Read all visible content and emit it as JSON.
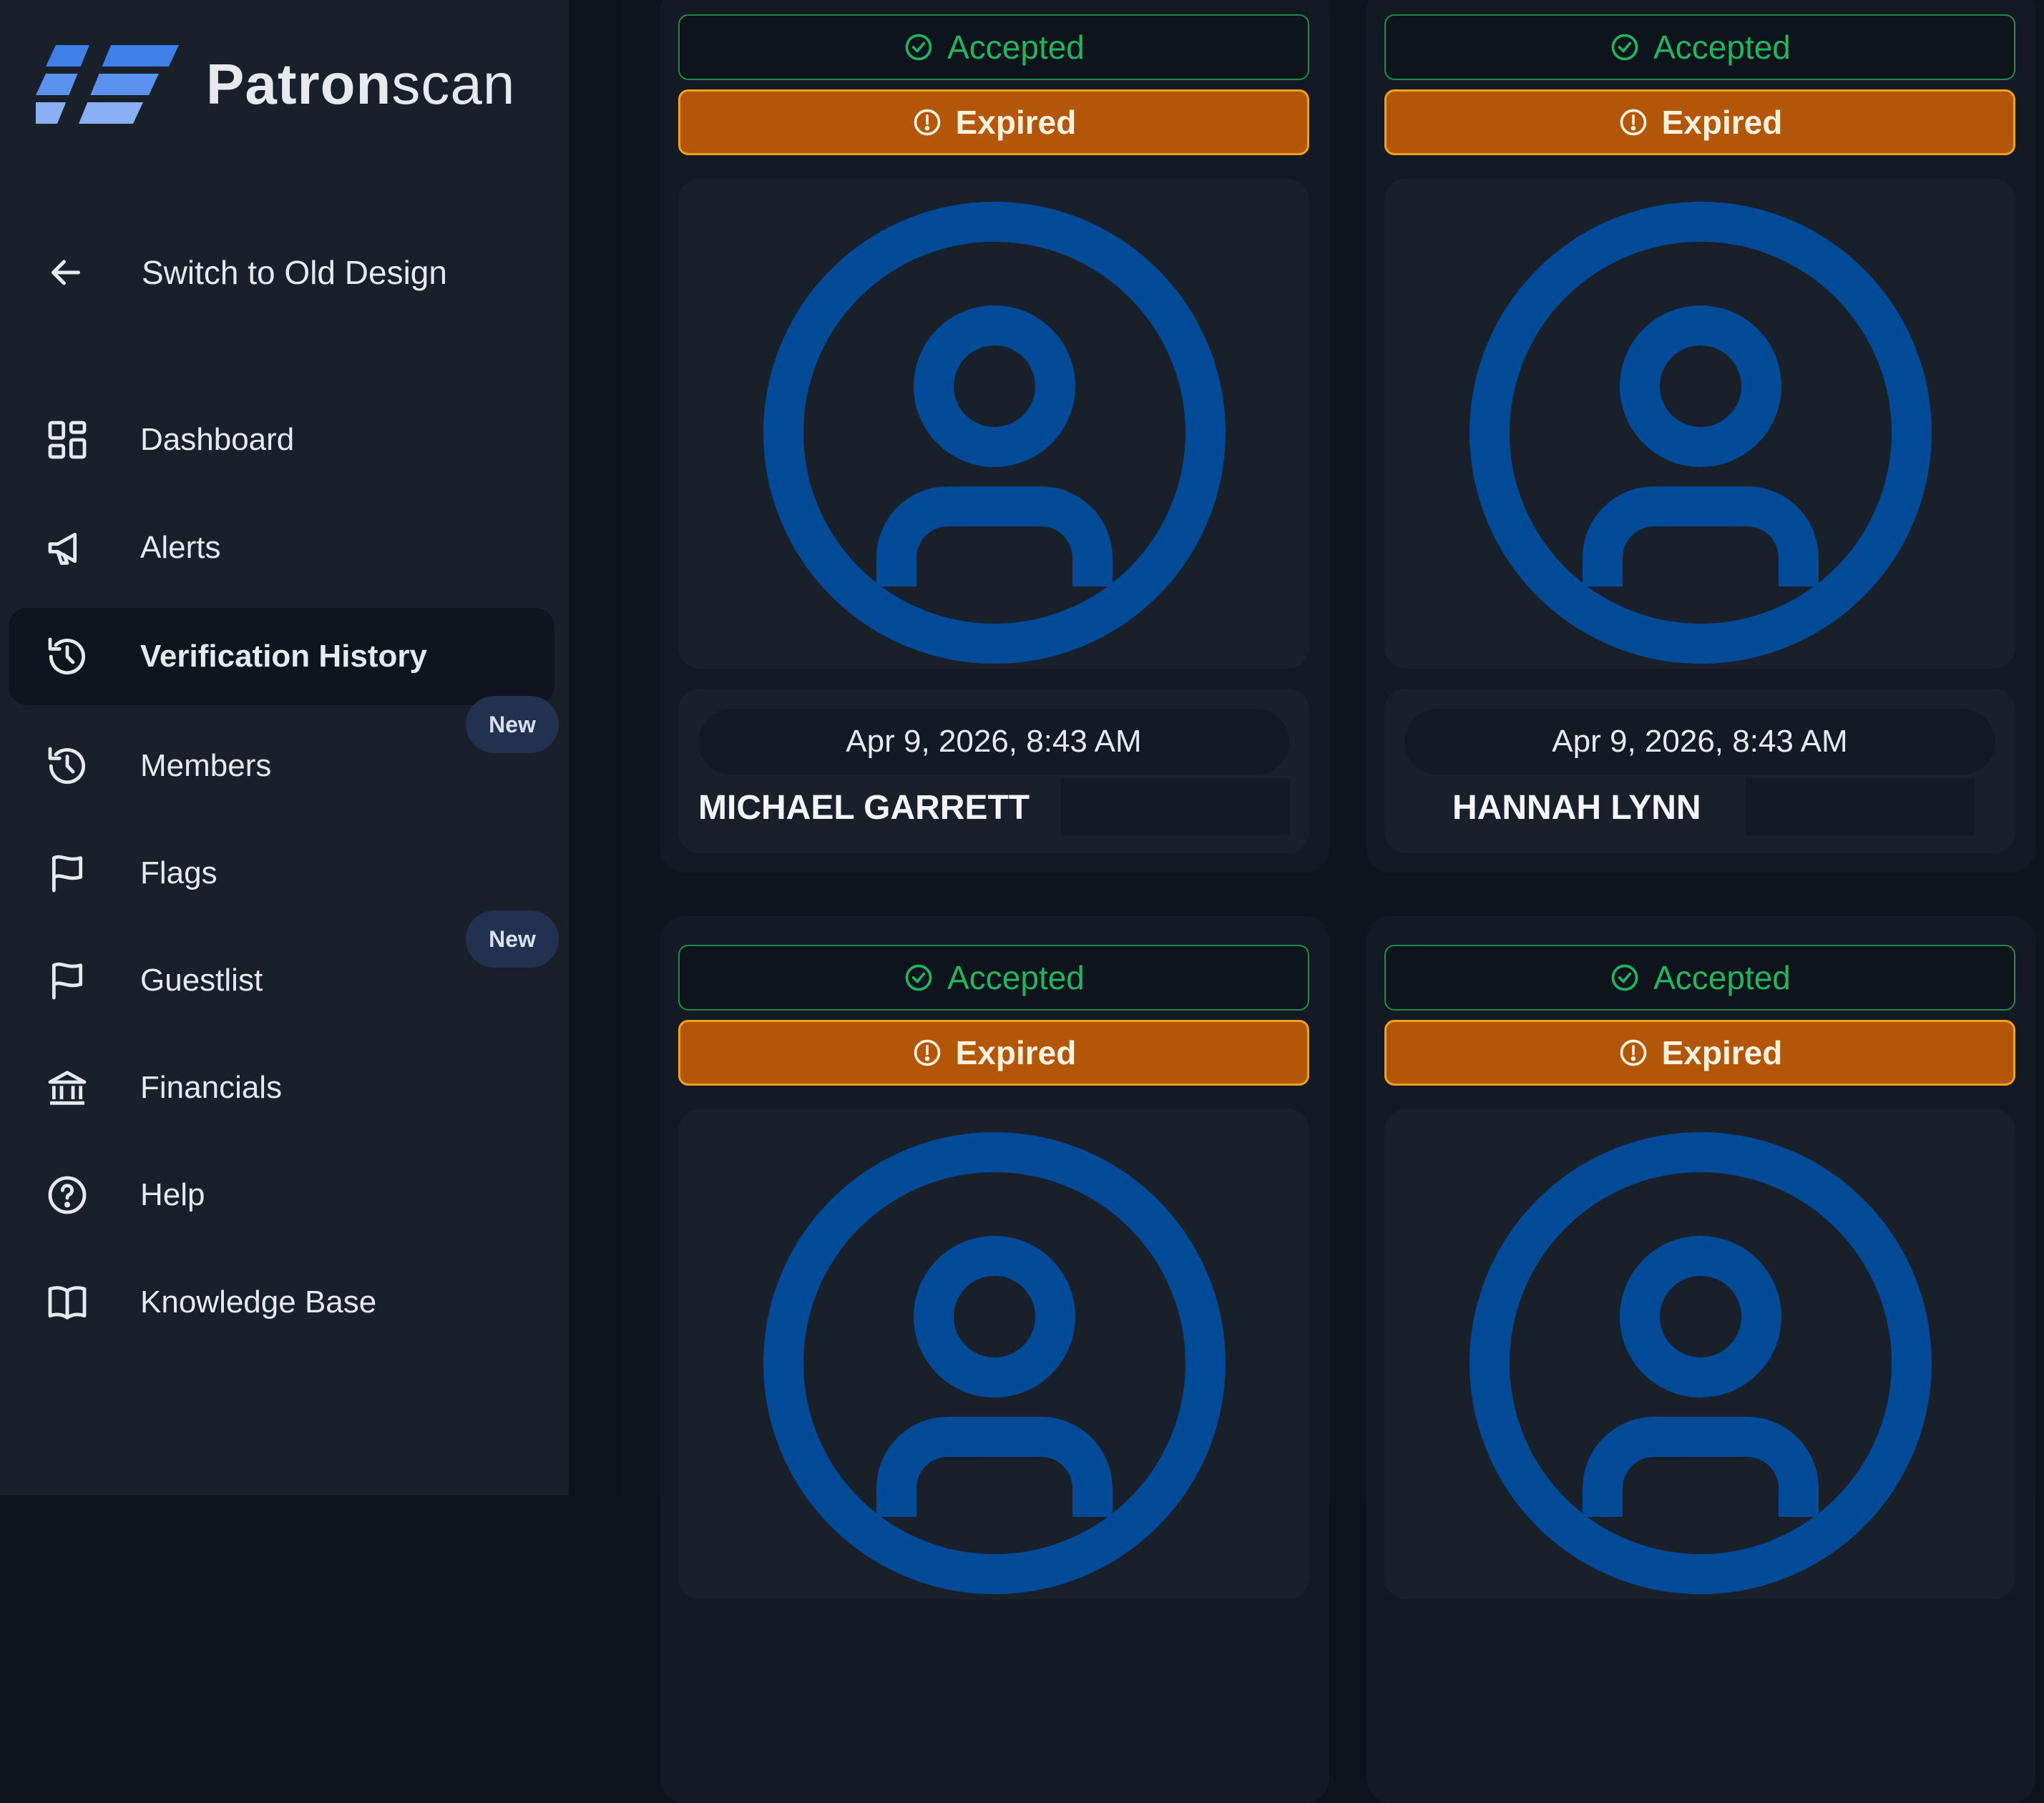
{
  "brand": {
    "name_bold": "Patron",
    "name_light": "scan",
    "mark_color": "#3f7fe8"
  },
  "sidebar": {
    "switch_label": "Switch to Old Design",
    "items": [
      {
        "label": "Dashboard",
        "icon": "dashboard-grid-icon"
      },
      {
        "label": "Alerts",
        "icon": "megaphone-icon"
      },
      {
        "label": "Verification History",
        "icon": "history-icon",
        "active": true
      },
      {
        "label": "Members",
        "icon": "history-icon",
        "badge": "New"
      },
      {
        "label": "Flags",
        "icon": "flag-icon"
      },
      {
        "label": "Guestlist",
        "icon": "flag-icon",
        "badge": "New"
      },
      {
        "label": "Financials",
        "icon": "bank-icon"
      },
      {
        "label": "Help",
        "icon": "help-circle-icon"
      },
      {
        "label": "Knowledge Base",
        "icon": "book-icon"
      }
    ]
  },
  "cards": [
    {
      "status": "Accepted",
      "warning": "Expired",
      "datetime": "Apr 9, 2026, 8:43 AM",
      "name": "MICHAEL GARRETT"
    },
    {
      "status": "Accepted",
      "warning": "Expired",
      "datetime": "Apr 9, 2026, 8:43 AM",
      "name": "HANNAH LYNN"
    },
    {
      "status": "Accepted",
      "warning": "Expired"
    },
    {
      "status": "Accepted",
      "warning": "Expired"
    }
  ],
  "colors": {
    "accepted": "#22b560",
    "expired_bg": "#b45607",
    "avatar": "#004a98"
  }
}
